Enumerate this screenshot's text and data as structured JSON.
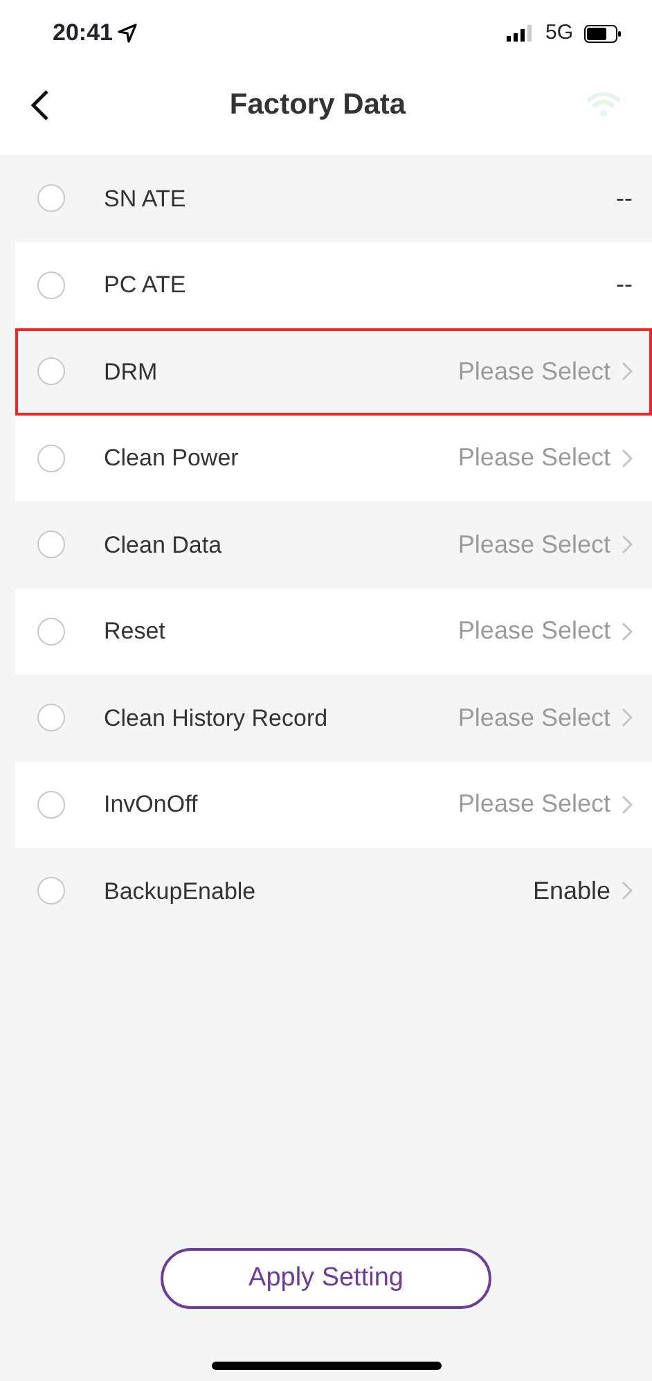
{
  "status_bar": {
    "time": "20:41",
    "network": "5G"
  },
  "header": {
    "title": "Factory Data"
  },
  "rows": [
    {
      "label": "SN ATE",
      "value": "--",
      "chevron": false,
      "checked": false,
      "highlighted": false
    },
    {
      "label": "PC ATE",
      "value": "--",
      "chevron": false,
      "checked": false,
      "highlighted": false
    },
    {
      "label": "DRM",
      "placeholder": "Please Select",
      "chevron": true,
      "checked": false,
      "highlighted": true
    },
    {
      "label": "Clean Power",
      "placeholder": "Please Select",
      "chevron": true,
      "checked": false,
      "highlighted": false
    },
    {
      "label": "Clean Data",
      "placeholder": "Please Select",
      "chevron": true,
      "checked": false,
      "highlighted": false
    },
    {
      "label": "Reset",
      "placeholder": "Please Select",
      "chevron": true,
      "checked": false,
      "highlighted": false
    },
    {
      "label": "Clean History Record",
      "placeholder": "Please Select",
      "chevron": true,
      "checked": false,
      "highlighted": false
    },
    {
      "label": "InvOnOff",
      "placeholder": "Please Select",
      "chevron": true,
      "checked": false,
      "highlighted": false
    },
    {
      "label": "BackupEnable",
      "value": "Enable",
      "chevron": true,
      "checked": false,
      "highlighted": false
    }
  ],
  "apply_button": "Apply Setting"
}
